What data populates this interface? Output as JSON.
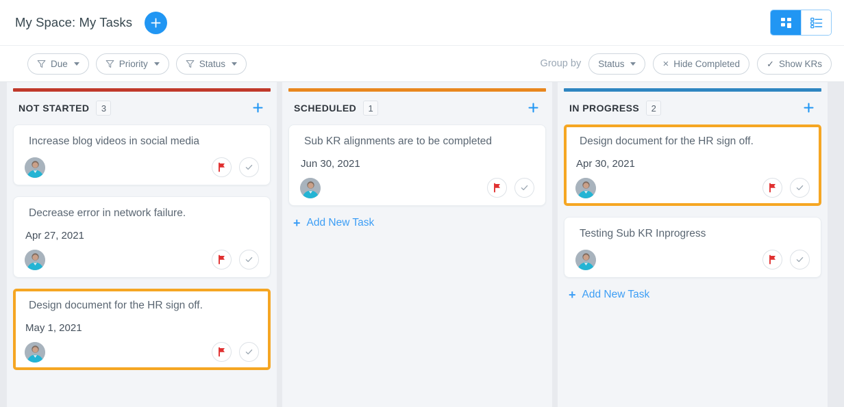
{
  "header": {
    "title": "My Space: My Tasks",
    "add_button_icon": "plus-icon",
    "views": [
      {
        "id": "grid",
        "icon": "grid-view-icon",
        "active": true
      },
      {
        "id": "list",
        "icon": "list-view-icon",
        "active": false
      }
    ]
  },
  "toolbar": {
    "filters": [
      {
        "label": "Due",
        "icon": "filter-icon"
      },
      {
        "label": "Priority",
        "icon": "filter-icon"
      },
      {
        "label": "Status",
        "icon": "filter-icon"
      }
    ],
    "group_by_label": "Group by",
    "group_by_value": "Status",
    "hide_completed_label": "Hide Completed",
    "hide_completed_icon": "x-icon",
    "show_krs_label": "Show KRs",
    "show_krs_icon": "check-icon"
  },
  "board": {
    "add_task_label": "Add New Task",
    "columns": [
      {
        "title": "NOT STARTED",
        "count": "3",
        "accent": "#c0392b",
        "add_icon": "plus-icon",
        "show_add_task": false,
        "cards": [
          {
            "title": "Increase blog videos in social media",
            "date": "",
            "selected": false,
            "flag_icon": "flag-icon",
            "complete_icon": "check-circle-icon",
            "avatar": "user-avatar"
          },
          {
            "title": "Decrease error in network failure.",
            "date": "Apr 27, 2021",
            "selected": false,
            "flag_icon": "flag-icon",
            "complete_icon": "check-circle-icon",
            "avatar": "user-avatar"
          },
          {
            "title": "Design document for the HR sign off.",
            "date": "May 1, 2021",
            "selected": true,
            "flag_icon": "flag-icon",
            "complete_icon": "check-circle-icon",
            "avatar": "user-avatar"
          }
        ]
      },
      {
        "title": "SCHEDULED",
        "count": "1",
        "accent": "#e8871e",
        "add_icon": "plus-icon",
        "show_add_task": true,
        "cards": [
          {
            "title": "Sub KR alignments are to be completed",
            "date": "Jun 30, 2021",
            "selected": false,
            "flag_icon": "flag-icon",
            "complete_icon": "check-circle-icon",
            "avatar": "user-avatar"
          }
        ]
      },
      {
        "title": "IN PROGRESS",
        "count": "2",
        "accent": "#2e86c1",
        "add_icon": "plus-icon",
        "show_add_task": true,
        "cards": [
          {
            "title": "Design document for the HR sign off.",
            "date": "Apr 30, 2021",
            "selected": true,
            "flag_icon": "flag-icon",
            "complete_icon": "check-circle-icon",
            "avatar": "user-avatar"
          },
          {
            "title": "Testing Sub KR Inprogress",
            "date": "",
            "selected": false,
            "flag_icon": "flag-icon",
            "complete_icon": "check-circle-icon",
            "avatar": "user-avatar"
          }
        ]
      }
    ]
  },
  "colors": {
    "accent_blue": "#2196f3",
    "selection_orange": "#f5a623",
    "flag_red": "#e03030",
    "not_started": "#c0392b",
    "scheduled": "#e8871e",
    "in_progress": "#2e86c1"
  }
}
